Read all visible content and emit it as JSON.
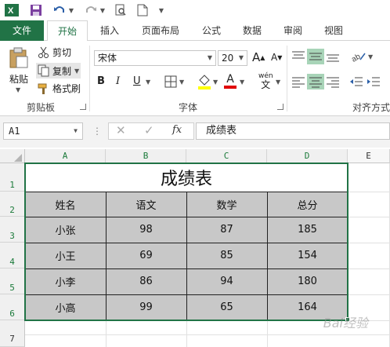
{
  "tabs": [
    "文件",
    "开始",
    "插入",
    "页面布局",
    "公式",
    "数据",
    "审阅",
    "视图"
  ],
  "ribbon": {
    "paste_label": "粘贴",
    "cut_label": "剪切",
    "copy_label": "复制",
    "format_painter_label": "格式刷",
    "clipboard_group": "剪贴板",
    "font_name": "宋体",
    "font_size": "20",
    "font_group": "字体",
    "align_group": "对齐方式",
    "bold": "B",
    "italic": "I",
    "underline": "U",
    "increase_font": "A",
    "decrease_font": "A",
    "phonetic_top": "wén",
    "phonetic_bottom": "文",
    "font_color_letter": "A"
  },
  "formula_bar": {
    "name_box": "A1",
    "fx": "fx",
    "formula": "成绩表"
  },
  "columns": [
    "A",
    "B",
    "C",
    "D",
    "E"
  ],
  "rows": [
    "1",
    "2",
    "3",
    "4",
    "5",
    "6",
    "7"
  ],
  "table": {
    "title": "成绩表",
    "headers": [
      "姓名",
      "语文",
      "数学",
      "总分"
    ],
    "rows": [
      [
        "小张",
        "98",
        "87",
        "185"
      ],
      [
        "小王",
        "69",
        "85",
        "154"
      ],
      [
        "小李",
        "86",
        "94",
        "180"
      ],
      [
        "小高",
        "99",
        "65",
        "164"
      ]
    ]
  },
  "watermark": "Bai经验",
  "colors": {
    "accent": "#217346",
    "fill": "#c8c8c8"
  }
}
